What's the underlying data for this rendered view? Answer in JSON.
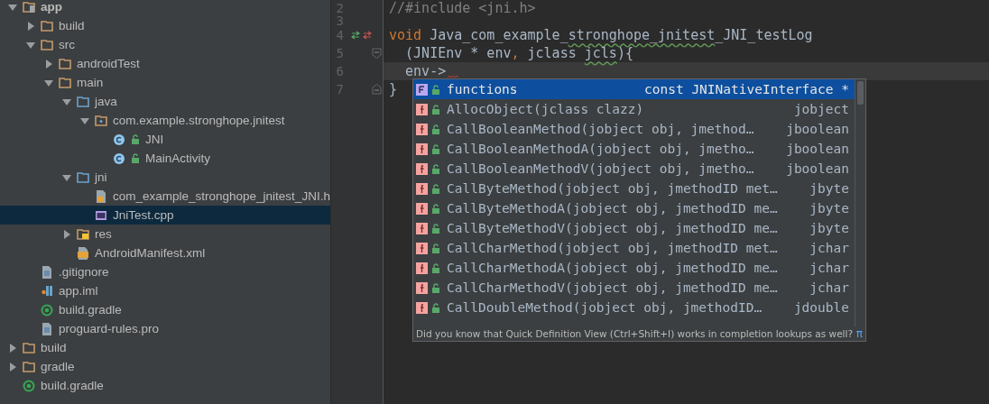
{
  "tree": [
    {
      "label": "app",
      "kind": "module",
      "expanded": true,
      "selected": false,
      "children": [
        {
          "label": "build",
          "kind": "folder",
          "expanded": false,
          "selected": false
        },
        {
          "label": "src",
          "kind": "folder",
          "expanded": true,
          "selected": false,
          "children": [
            {
              "label": "androidTest",
              "kind": "folder",
              "expanded": false,
              "selected": false
            },
            {
              "label": "main",
              "kind": "folder",
              "expanded": true,
              "selected": false,
              "children": [
                {
                  "label": "java",
                  "kind": "source-folder",
                  "expanded": true,
                  "selected": false,
                  "children": [
                    {
                      "label": "com.example.stronghope.jnitest",
                      "kind": "package",
                      "expanded": true,
                      "selected": false,
                      "children": [
                        {
                          "label": "JNI",
                          "kind": "class",
                          "selected": false
                        },
                        {
                          "label": "MainActivity",
                          "kind": "class",
                          "selected": false
                        }
                      ]
                    }
                  ]
                },
                {
                  "label": "jni",
                  "kind": "source-folder",
                  "expanded": true,
                  "selected": false,
                  "children": [
                    {
                      "label": "com_example_stronghope_jnitest_JNI.h",
                      "kind": "header",
                      "selected": false
                    },
                    {
                      "label": "JniTest.cpp",
                      "kind": "cpp",
                      "selected": true
                    }
                  ]
                },
                {
                  "label": "res",
                  "kind": "res-folder",
                  "expanded": false,
                  "selected": false
                },
                {
                  "label": "AndroidManifest.xml",
                  "kind": "manifest",
                  "selected": false
                }
              ]
            }
          ]
        },
        {
          "label": ".gitignore",
          "kind": "text-file",
          "selected": false
        },
        {
          "label": "app.iml",
          "kind": "iml",
          "selected": false
        },
        {
          "label": "build.gradle",
          "kind": "gradle",
          "selected": false
        },
        {
          "label": "proguard-rules.pro",
          "kind": "text-file",
          "selected": false
        }
      ]
    },
    {
      "label": "build",
      "kind": "folder",
      "expanded": false,
      "selected": false
    },
    {
      "label": "gradle",
      "kind": "folder",
      "expanded": false,
      "selected": false
    },
    {
      "label": "build.gradle",
      "kind": "gradle",
      "selected": false
    }
  ],
  "editor": {
    "lines": [
      {
        "number": "2",
        "current": false,
        "segments": [
          {
            "kind": "comment",
            "text": "//#include <jni.h>"
          }
        ]
      },
      {
        "number": "3",
        "current": false
      },
      {
        "number": "4",
        "current": false,
        "gutter_marker": true,
        "segments": [
          {
            "kind": "keyword",
            "text": "void"
          },
          {
            "kind": "plain",
            "text": " Java_com_example_"
          },
          {
            "kind": "plain",
            "text": "stronghope_jnitest",
            "warning": true
          },
          {
            "kind": "plain",
            "text": "_JNI_testLog"
          }
        ]
      },
      {
        "number": "5",
        "current": false,
        "fold_start": true,
        "segments": [
          {
            "kind": "plain",
            "text": "  (JNIEnv * env"
          },
          {
            "kind": "keyword",
            "text": ","
          },
          {
            "kind": "plain",
            "text": " jclass "
          },
          {
            "kind": "plain",
            "text": "jcls",
            "warning": true
          },
          {
            "kind": "plain",
            "text": "){"
          }
        ]
      },
      {
        "number": "6",
        "current": true,
        "error_mark": true,
        "segments": [
          {
            "kind": "plain",
            "text": "  env->"
          }
        ]
      },
      {
        "number": "7",
        "current": false,
        "fold_end": true,
        "segments": [
          {
            "kind": "plain",
            "text": "}"
          }
        ]
      }
    ]
  },
  "completion": {
    "items": [
      {
        "kind": "field",
        "name": "functions",
        "type": "const JNINativeInterface *",
        "selected": true
      },
      {
        "kind": "function",
        "name": "AllocObject(jclass clazz)",
        "type": "jobject",
        "selected": false
      },
      {
        "kind": "function",
        "name": "CallBooleanMethod(jobject obj, jmethod…",
        "type": "jboolean",
        "selected": false
      },
      {
        "kind": "function",
        "name": "CallBooleanMethodA(jobject obj, jmetho…",
        "type": "jboolean",
        "selected": false
      },
      {
        "kind": "function",
        "name": "CallBooleanMethodV(jobject obj, jmetho…",
        "type": "jboolean",
        "selected": false
      },
      {
        "kind": "function",
        "name": "CallByteMethod(jobject obj, jmethodID met…",
        "type": "jbyte",
        "selected": false
      },
      {
        "kind": "function",
        "name": "CallByteMethodA(jobject obj, jmethodID me…",
        "type": "jbyte",
        "selected": false
      },
      {
        "kind": "function",
        "name": "CallByteMethodV(jobject obj, jmethodID me…",
        "type": "jbyte",
        "selected": false
      },
      {
        "kind": "function",
        "name": "CallCharMethod(jobject obj, jmethodID met…",
        "type": "jchar",
        "selected": false
      },
      {
        "kind": "function",
        "name": "CallCharMethodA(jobject obj, jmethodID me…",
        "type": "jchar",
        "selected": false
      },
      {
        "kind": "function",
        "name": "CallCharMethodV(jobject obj, jmethodID me…",
        "type": "jchar",
        "selected": false
      },
      {
        "kind": "function",
        "name": "CallDoubleMethod(jobject obj, jmethodID…",
        "type": "jdouble",
        "selected": false
      }
    ],
    "hint": "Did you know that Quick Definition View (Ctrl+Shift+I) works in completion lookups as well?",
    "hint_symbol": "π"
  }
}
